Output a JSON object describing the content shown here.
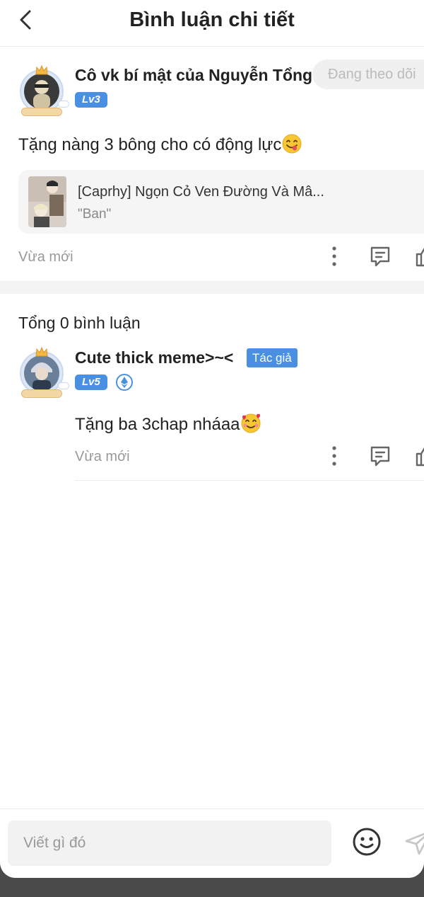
{
  "header": {
    "title": "Bình luận chi tiết"
  },
  "main_comment": {
    "username": "Cô vk bí mật của Nguyễn Tổng~",
    "level": "Lv3",
    "follow_label": "Đang theo dõi",
    "text": "Tặng nàng 3 bông cho có động lực",
    "book": {
      "title": "[Caprhy] Ngọn Cỏ Ven Đường Và Mâ...",
      "subtitle": "\"Ban\""
    },
    "time": "Vừa mới"
  },
  "replies": {
    "total_label": "Tổng 0 bình luận",
    "items": [
      {
        "username": "Cute thick meme>~<",
        "author_tag": "Tác giả",
        "level": "Lv5",
        "text": "Tặng ba 3chap nháaa",
        "time": "Vừa mới"
      }
    ]
  },
  "composer": {
    "placeholder": "Viết gì đó"
  },
  "colors": {
    "accent": "#4a90e2",
    "muted": "#999999",
    "divider": "#ececec"
  },
  "icons": [
    "back-arrow-icon",
    "more-vertical-icon",
    "comment-icon",
    "like-icon",
    "smiley-icon",
    "send-icon",
    "yum-emoji-icon",
    "heart-eyes-emoji-icon",
    "crown-icon",
    "ethereum-icon"
  ]
}
